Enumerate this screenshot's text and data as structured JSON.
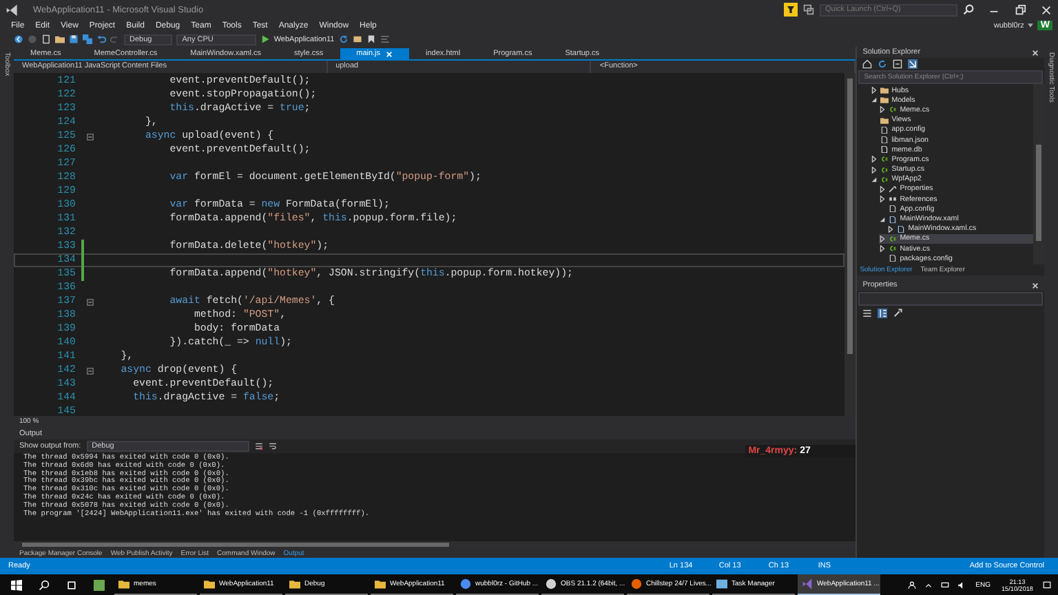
{
  "window": {
    "title": "WebApplication11 - Microsoft Visual Studio",
    "quick_launch_placeholder": "Quick Launch (Ctrl+Q)",
    "user": "wubbl0rz",
    "avatar_letter": "W"
  },
  "menu": [
    "File",
    "Edit",
    "View",
    "Project",
    "Build",
    "Debug",
    "Team",
    "Tools",
    "Test",
    "Analyze",
    "Window",
    "Help"
  ],
  "toolbar": {
    "configuration": "Debug",
    "platform": "Any CPU",
    "run_target": "WebApplication11"
  },
  "side_strip_left": "Toolbox",
  "side_strip_right": "Diagnostic Tools",
  "document_tabs": [
    {
      "label": "Meme.cs",
      "selected": false
    },
    {
      "label": "MemeController.cs",
      "selected": false
    },
    {
      "label": "MainWindow.xaml.cs",
      "selected": false
    },
    {
      "label": "style.css",
      "selected": false
    },
    {
      "label": "main.js",
      "selected": true
    },
    {
      "label": "index.html",
      "selected": false
    },
    {
      "label": "Program.cs",
      "selected": false
    },
    {
      "label": "Startup.cs",
      "selected": false
    }
  ],
  "navigation_bar": {
    "project": "WebApplication11 JavaScript Content Files",
    "member": "upload",
    "scope": "<Function>"
  },
  "editor": {
    "zoom": "100 %",
    "lines": [
      {
        "number": "121",
        "foldable": false,
        "modified": false,
        "current": false,
        "segments": [
          {
            "text": "            event.preventDefault();",
            "kind": "plain"
          }
        ]
      },
      {
        "number": "122",
        "foldable": false,
        "modified": false,
        "current": false,
        "segments": [
          {
            "text": "            event.stopPropagation();",
            "kind": "plain"
          }
        ]
      },
      {
        "number": "123",
        "foldable": false,
        "modified": false,
        "current": false,
        "segments": [
          {
            "text": "            this",
            "kind": "keyword"
          },
          {
            "text": ".dragActive = ",
            "kind": "plain"
          },
          {
            "text": "true",
            "kind": "keyword"
          },
          {
            "text": ";",
            "kind": "plain"
          }
        ]
      },
      {
        "number": "124",
        "foldable": false,
        "modified": false,
        "current": false,
        "segments": [
          {
            "text": "        },",
            "kind": "plain"
          }
        ]
      },
      {
        "number": "125",
        "foldable": true,
        "modified": false,
        "current": false,
        "segments": [
          {
            "text": "        async",
            "kind": "keyword"
          },
          {
            "text": " upload(event) {",
            "kind": "plain"
          }
        ]
      },
      {
        "number": "126",
        "foldable": false,
        "modified": false,
        "current": false,
        "segments": [
          {
            "text": "            event.preventDefault();",
            "kind": "plain"
          }
        ]
      },
      {
        "number": "127",
        "foldable": false,
        "modified": false,
        "current": false
      },
      {
        "number": "128",
        "foldable": false,
        "modified": false,
        "current": false,
        "segments": [
          {
            "text": "            var",
            "kind": "keyword"
          },
          {
            "text": " formEl = document.getElementById(",
            "kind": "plain"
          },
          {
            "text": "\"popup-form\"",
            "kind": "string"
          },
          {
            "text": ");",
            "kind": "plain"
          }
        ]
      },
      {
        "number": "129",
        "foldable": false,
        "modified": false,
        "current": false
      },
      {
        "number": "130",
        "foldable": false,
        "modified": false,
        "current": false,
        "segments": [
          {
            "text": "            var",
            "kind": "keyword"
          },
          {
            "text": " formData = ",
            "kind": "plain"
          },
          {
            "text": "new",
            "kind": "keyword"
          },
          {
            "text": " FormData(formEl);",
            "kind": "plain"
          }
        ]
      },
      {
        "number": "131",
        "foldable": false,
        "modified": false,
        "current": false,
        "segments": [
          {
            "text": "            formData.append(",
            "kind": "plain"
          },
          {
            "text": "\"files\"",
            "kind": "string"
          },
          {
            "text": ", ",
            "kind": "plain"
          },
          {
            "text": "this",
            "kind": "keyword"
          },
          {
            "text": ".popup.form.file);",
            "kind": "plain"
          }
        ]
      },
      {
        "number": "132",
        "foldable": false,
        "modified": false,
        "current": false
      },
      {
        "number": "133",
        "foldable": false,
        "modified": true,
        "current": false,
        "segments": [
          {
            "text": "            formData.delete(",
            "kind": "plain"
          },
          {
            "text": "\"hotkey\"",
            "kind": "string"
          },
          {
            "text": ");",
            "kind": "plain"
          }
        ]
      },
      {
        "number": "134",
        "foldable": false,
        "modified": true,
        "current": true
      },
      {
        "number": "135",
        "foldable": false,
        "modified": true,
        "current": false,
        "segments": [
          {
            "text": "            formData.append(",
            "kind": "plain"
          },
          {
            "text": "\"hotkey\"",
            "kind": "string"
          },
          {
            "text": ", JSON.stringify(",
            "kind": "plain"
          },
          {
            "text": "this",
            "kind": "keyword"
          },
          {
            "text": ".popup.form.hotkey));",
            "kind": "plain"
          }
        ]
      },
      {
        "number": "136",
        "foldable": false,
        "modified": false,
        "current": false
      },
      {
        "number": "137",
        "foldable": true,
        "modified": false,
        "current": false,
        "segments": [
          {
            "text": "            await",
            "kind": "keyword"
          },
          {
            "text": " fetch(",
            "kind": "plain"
          },
          {
            "text": "'/api/Memes'",
            "kind": "string"
          },
          {
            "text": ", {",
            "kind": "plain"
          }
        ]
      },
      {
        "number": "138",
        "foldable": false,
        "modified": false,
        "current": false,
        "segments": [
          {
            "text": "                method: ",
            "kind": "plain"
          },
          {
            "text": "\"POST\"",
            "kind": "string"
          },
          {
            "text": ",",
            "kind": "plain"
          }
        ]
      },
      {
        "number": "139",
        "foldable": false,
        "modified": false,
        "current": false,
        "segments": [
          {
            "text": "                body: formData",
            "kind": "plain"
          }
        ]
      },
      {
        "number": "140",
        "foldable": false,
        "modified": false,
        "current": false,
        "segments": [
          {
            "text": "            }).catch(_ => ",
            "kind": "plain"
          },
          {
            "text": "null",
            "kind": "keyword"
          },
          {
            "text": ");",
            "kind": "plain"
          }
        ]
      },
      {
        "number": "141",
        "foldable": false,
        "modified": false,
        "current": false,
        "segments": [
          {
            "text": "    },",
            "kind": "plain"
          }
        ]
      },
      {
        "number": "142",
        "foldable": true,
        "modified": false,
        "current": false,
        "segments": [
          {
            "text": "    async",
            "kind": "keyword"
          },
          {
            "text": " drop(event) {",
            "kind": "plain"
          }
        ]
      },
      {
        "number": "143",
        "foldable": false,
        "modified": false,
        "current": false,
        "segments": [
          {
            "text": "      event.preventDefault();",
            "kind": "plain"
          }
        ]
      },
      {
        "number": "144",
        "foldable": false,
        "modified": false,
        "current": false,
        "segments": [
          {
            "text": "      this",
            "kind": "keyword"
          },
          {
            "text": ".dragActive = ",
            "kind": "plain"
          },
          {
            "text": "false",
            "kind": "keyword"
          },
          {
            "text": ";",
            "kind": "plain"
          }
        ]
      },
      {
        "number": "145",
        "foldable": false,
        "modified": false,
        "current": false
      }
    ]
  },
  "output": {
    "title": "Output",
    "source_label": "Show output from:",
    "source": "Debug",
    "lines": [
      "The thread 0x5994 has exited with code 0 (0x0).",
      "The thread 0x6d0 has exited with code 0 (0x0).",
      "The thread 0x1eb8 has exited with code 0 (0x0).",
      "The thread 0x39bc has exited with code 0 (0x0).",
      "The thread 0x310c has exited with code 0 (0x0).",
      "The thread 0x24c has exited with code 0 (0x0).",
      "The thread 0x5078 has exited with code 0 (0x0).",
      "The program '[2424] WebApplication11.exe' has exited with code -1 (0xffffffff)."
    ]
  },
  "chat_overlay": {
    "user": "Mr_4rmyy:",
    "message": "27"
  },
  "bottom_tabs": [
    {
      "label": "Package Manager Console",
      "selected": false
    },
    {
      "label": "Web Publish Activity",
      "selected": false
    },
    {
      "label": "Error List",
      "selected": false
    },
    {
      "label": "Command Window",
      "selected": false
    },
    {
      "label": "Output",
      "selected": true
    }
  ],
  "solution_explorer": {
    "title": "Solution Explorer",
    "search_placeholder": "Search Solution Explorer (Ctrl+;)",
    "items": [
      {
        "label": "Hubs",
        "kind": "folder",
        "expanded": false,
        "selected": false
      },
      {
        "label": "Models",
        "kind": "folder",
        "expanded": true,
        "selected": false,
        "children": [
          {
            "label": "Meme.cs",
            "kind": "cs",
            "expanded": false,
            "selected": false
          }
        ]
      },
      {
        "label": "Views",
        "kind": "folder",
        "selected": false
      },
      {
        "label": "app.config",
        "kind": "config",
        "selected": false
      },
      {
        "label": "libman.json",
        "kind": "json",
        "selected": false
      },
      {
        "label": "meme.db",
        "kind": "db",
        "selected": false
      },
      {
        "label": "Program.cs",
        "kind": "cs",
        "expanded": false,
        "selected": false
      },
      {
        "label": "Startup.cs",
        "kind": "cs",
        "expanded": false,
        "selected": false
      },
      {
        "label": "WpfApp2",
        "kind": "project",
        "expanded": true,
        "selected": false,
        "children": [
          {
            "label": "Properties",
            "kind": "properties",
            "expanded": false,
            "selected": false
          },
          {
            "label": "References",
            "kind": "references",
            "expanded": false,
            "selected": false
          },
          {
            "label": "App.config",
            "kind": "config",
            "selected": false
          },
          {
            "label": "MainWindow.xaml",
            "kind": "xaml",
            "expanded": true,
            "selected": false,
            "children": [
              {
                "label": "MainWindow.xaml.cs",
                "kind": "xaml",
                "expanded": false,
                "selected": false
              }
            ]
          },
          {
            "label": "Meme.cs",
            "kind": "cs",
            "expanded": false,
            "selected": true
          },
          {
            "label": "Native.cs",
            "kind": "cs",
            "expanded": false,
            "selected": false
          },
          {
            "label": "packages.config",
            "kind": "config",
            "selected": false
          }
        ]
      }
    ],
    "tabs": [
      {
        "label": "Solution Explorer",
        "selected": true
      },
      {
        "label": "Team Explorer",
        "selected": false
      }
    ]
  },
  "properties": {
    "title": "Properties"
  },
  "status_bar": {
    "state": "Ready",
    "line": "Ln 134",
    "column": "Col 13",
    "char": "Ch 13",
    "mode": "INS",
    "source_control": "Add to Source Control"
  },
  "taskbar": {
    "items": [
      {
        "label": "memes",
        "kind": "folder",
        "selected": false
      },
      {
        "label": "WebApplication11",
        "kind": "folder",
        "selected": false
      },
      {
        "label": "Debug",
        "kind": "folder",
        "selected": false
      },
      {
        "label": "WebApplication11",
        "kind": "folder",
        "selected": false
      },
      {
        "label": "wubbl0rz - GitHub ...",
        "kind": "chrome",
        "selected": false
      },
      {
        "label": "OBS 21.1.2 (64bit, ...",
        "kind": "obs",
        "selected": false
      },
      {
        "label": "Chillstep 24/7 Lives...",
        "kind": "firefox",
        "selected": false
      },
      {
        "label": "Task Manager",
        "kind": "taskmgr",
        "selected": false
      },
      {
        "label": "WebApplication11 ...",
        "kind": "vs",
        "selected": true
      }
    ],
    "language": "ENG",
    "time": "21:13",
    "date": "15/10/2018"
  }
}
